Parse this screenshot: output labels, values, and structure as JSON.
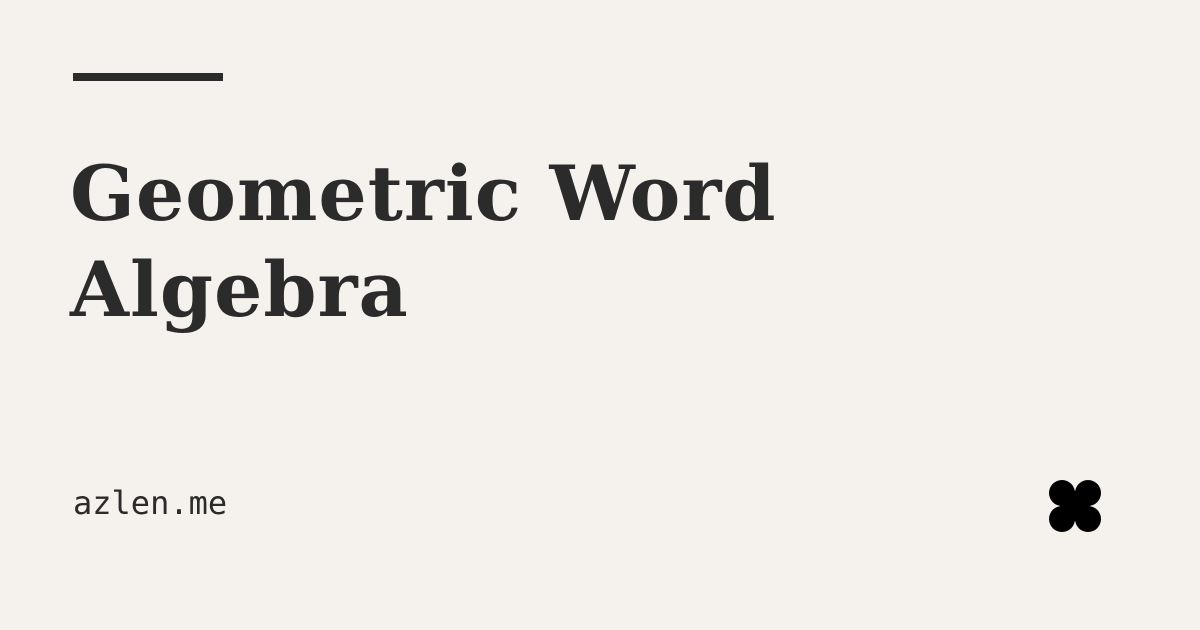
{
  "card": {
    "title": "Geometric Word Algebra",
    "site": "azlen.me",
    "logo_icon": "quatrefoil-logo-icon",
    "colors": {
      "background": "#f5f2ee",
      "text": "#2b2b2b",
      "logo": "#000000"
    }
  }
}
